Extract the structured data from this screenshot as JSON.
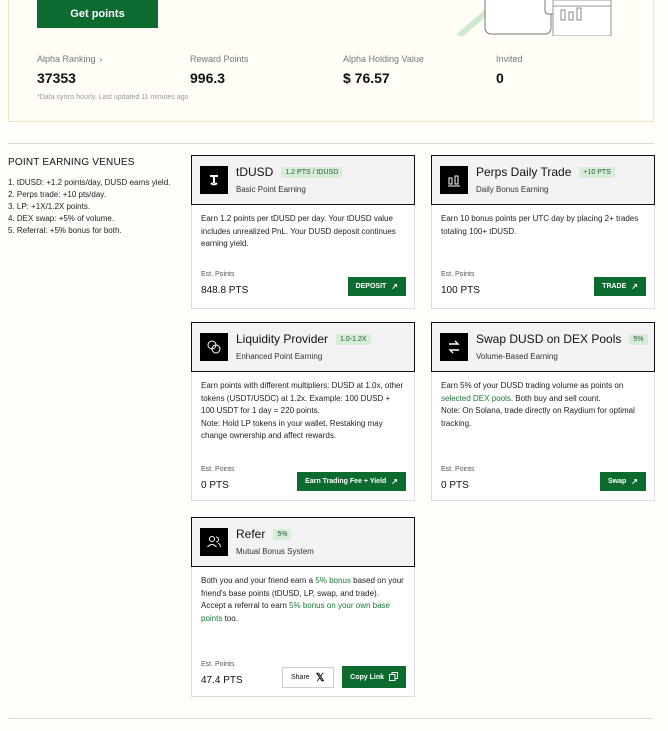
{
  "header": {
    "get_points_label": "Get points",
    "stats": [
      {
        "label": "Alpha Ranking",
        "value": "37353"
      },
      {
        "label": "Reward Points",
        "value": "996.3"
      },
      {
        "label": "Alpha Holding Value",
        "value": "$ 76.57"
      },
      {
        "label": "Invited",
        "value": "0"
      }
    ],
    "sync_note": "*Data syncs hourly. Last updated 11 minutes ago"
  },
  "venues": {
    "title": "POINT EARNING VENUES",
    "items": [
      "1. tDUSD: +1.2 points/day, DUSD earns yield.",
      "2. Perps trade: +10 pts/day.",
      "3. LP: +1X/1.2X points.",
      "4. DEX swap: +5% of volume.",
      "5. Referral: +5% bonus for both."
    ]
  },
  "cards": {
    "tdusd": {
      "title": "tDUSD",
      "tag": "1.2 PTS / tDUSD",
      "subtitle": "Basic Point Earning",
      "body": "Earn 1.2 points per tDUSD per day. Your tDUSD value includes unrealized PnL. Your DUSD deposit continues earning yield.",
      "est_label": "Est. Points",
      "est_value": "848.8 PTS",
      "button": "DEPOSIT"
    },
    "perps": {
      "title": "Perps Daily Trade",
      "tag": "+10 PTS",
      "subtitle": "Daily Bonus Earning",
      "body": "Earn 10 bonus points per UTC day by placing 2+ trades totaling 100+ tDUSD.",
      "est_label": "Est. Points",
      "est_value": "100 PTS",
      "button": "TRADE"
    },
    "lp": {
      "title": "Liquidity Provider",
      "tag": "1.0-1.2X",
      "subtitle": "Enhanced Point Earning",
      "body": "Earn points with different multipliers: DUSD at 1.0x, other tokens (USDT/USDC) at 1.2x. Example: 100 DUSD + 100 USDT for 1 day = 220 points.",
      "note": "Note: Hold LP tokens in your wallet. Restaking may change ownership and affect rewards.",
      "est_label": "Est. Points",
      "est_value": "0 PTS",
      "button": "Earn Trading Fee + Yield"
    },
    "swap": {
      "title": "Swap DUSD on DEX Pools",
      "tag": "5%",
      "subtitle": "Volume-Based Earning",
      "body_pre": "Earn 5% of your DUSD trading volume as points on ",
      "body_link": "selected DEX pools",
      "body_post": ". Both buy and sell count.",
      "note": "Note: On Solana, trade directly on Raydium for optimal tracking.",
      "est_label": "Est. Points",
      "est_value": "0 PTS",
      "button": "Swap"
    },
    "refer": {
      "title": "Refer",
      "tag": "5%",
      "subtitle": "Mutual Bonus System",
      "body_pre": "Both you and your friend earn a ",
      "body_link": "5% bonus",
      "body_post": " based on your friend's base points (tDUSD, LP, swap, and trade).",
      "body2_pre": "Accept a referral to earn ",
      "body2_link": "5% bonus on your own base points",
      "body2_post": " too.",
      "est_label": "Est. Points",
      "est_value": "47.4 PTS",
      "share_label": "Share",
      "copy_label": "Copy Link"
    }
  },
  "colors": {
    "accent": "#0d6b2f",
    "tag_bg": "#d7ecd9"
  }
}
